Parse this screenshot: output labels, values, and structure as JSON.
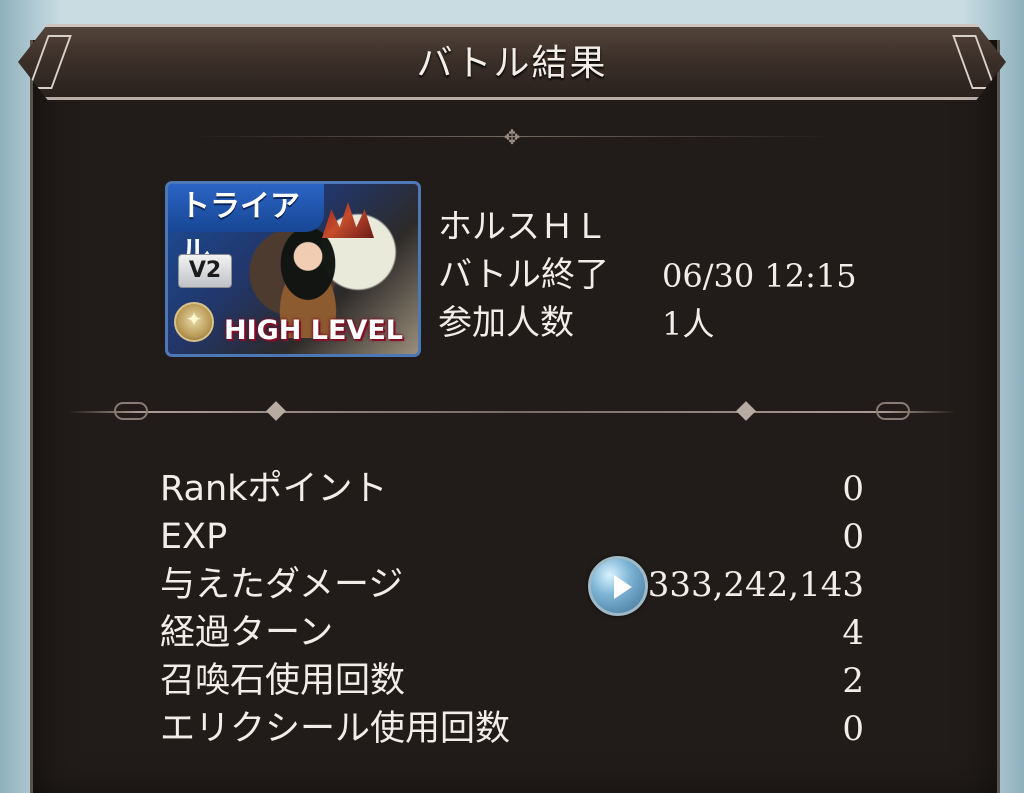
{
  "header": {
    "title": "バトル結果"
  },
  "quest": {
    "banner_tag": "トライアル",
    "version_badge": "V2",
    "level_label": "HIGH LEVEL",
    "name": "ホルスＨＬ",
    "end_label": "バトル終了",
    "end_value": "06/30 12:15",
    "participants_label": "参加人数",
    "participants_value": "1人"
  },
  "results": [
    {
      "label": "Rankポイント",
      "value": "0"
    },
    {
      "label": "EXP",
      "value": "0"
    },
    {
      "label": "与えたダメージ",
      "value": "333,242,143"
    },
    {
      "label": "経過ターン",
      "value": "4"
    },
    {
      "label": "召喚石使用回数",
      "value": "2"
    },
    {
      "label": "エリクシール使用回数",
      "value": "0"
    }
  ],
  "icons": {
    "damage_detail": "play-arrow-icon",
    "medal": "medal-icon"
  },
  "colors": {
    "panel_background": "#211c19",
    "text": "#f2ede8",
    "banner_blue": "#2b64c5",
    "level_outline": "#8b1028",
    "button_blue": "#7fb5d6"
  }
}
